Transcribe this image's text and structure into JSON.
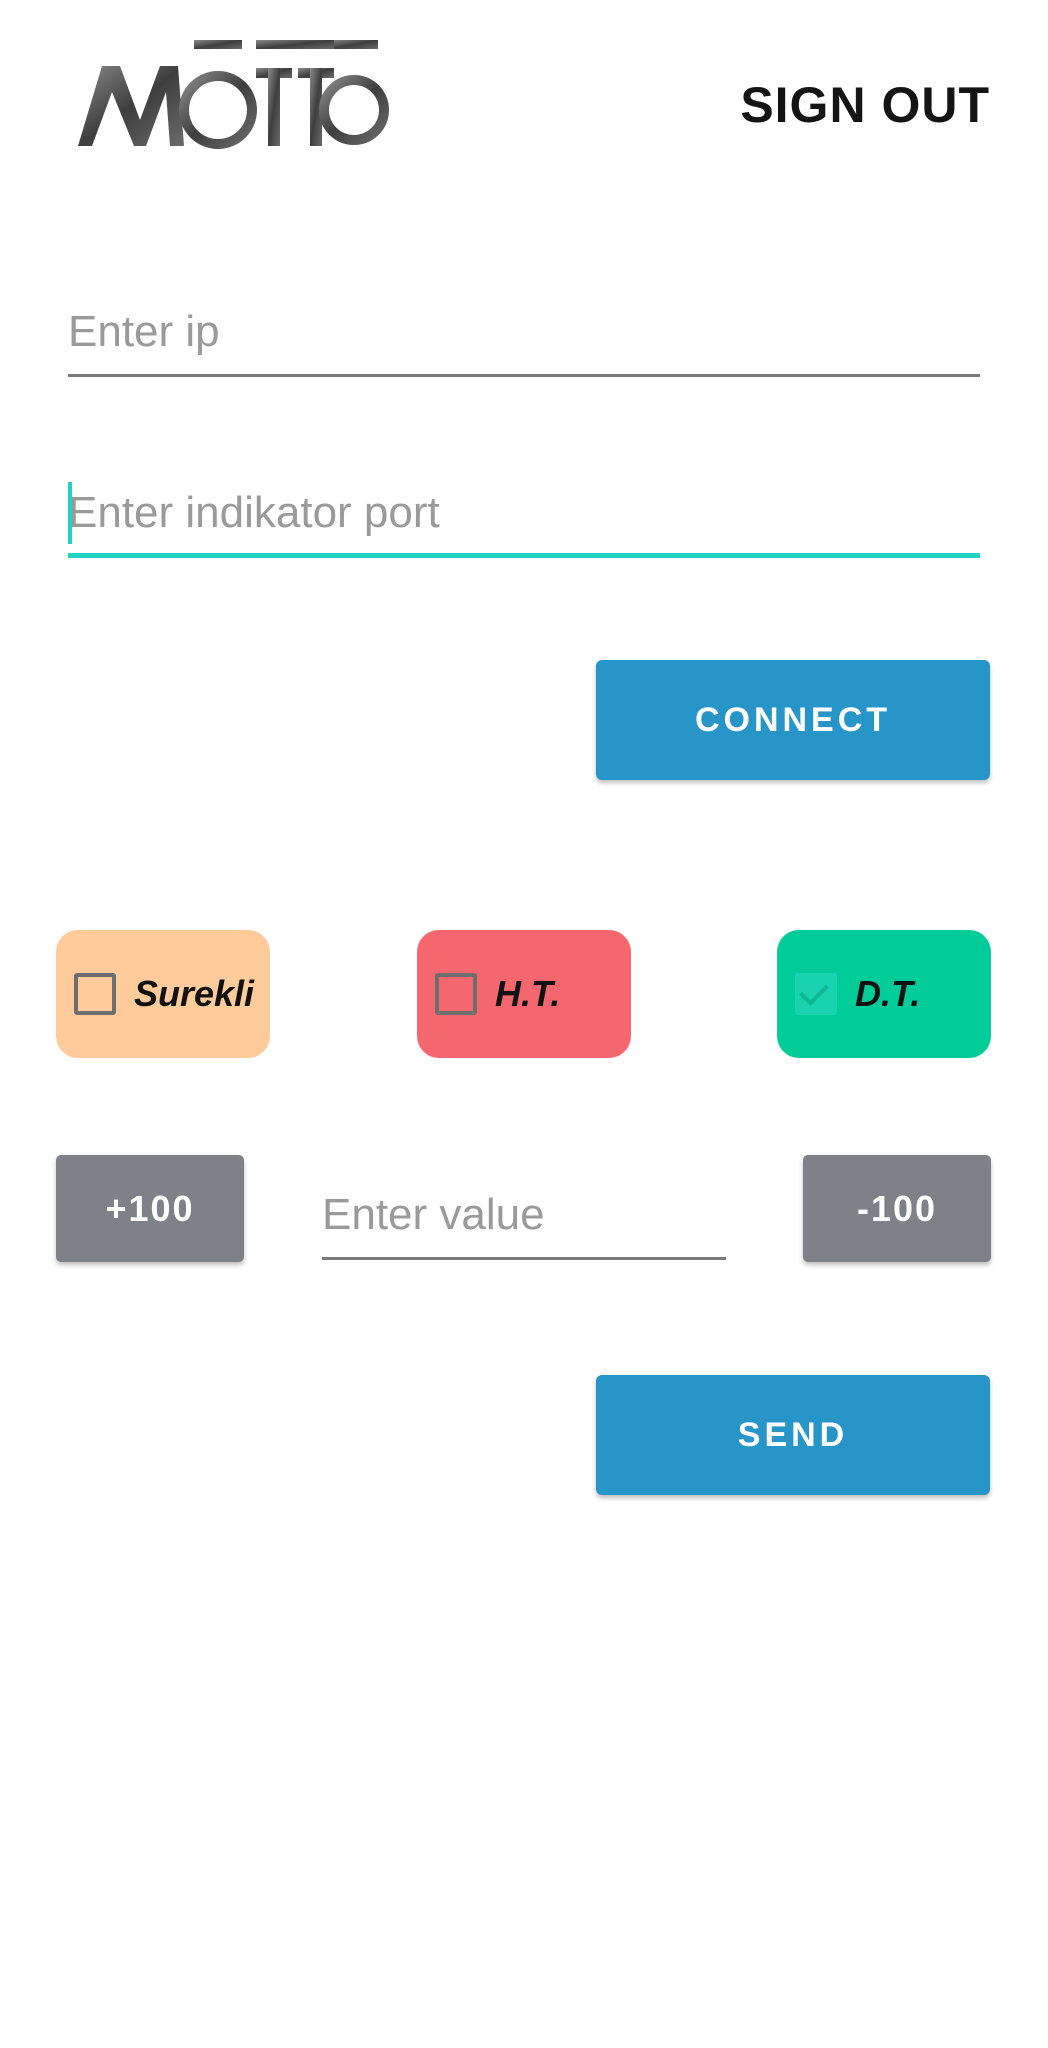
{
  "header": {
    "logo_text": "MŌTTŌ",
    "sign_out_label": "SIGN OUT"
  },
  "connection": {
    "ip_placeholder": "Enter ip",
    "ip_value": "",
    "port_placeholder": "Enter indikator port",
    "port_value": "",
    "connect_label": "CONNECT"
  },
  "modes": [
    {
      "label": "Surekli",
      "checked": false,
      "color": "#ffcb9a"
    },
    {
      "label": "H.T.",
      "checked": false,
      "color": "#f5676f"
    },
    {
      "label": "D.T.",
      "checked": true,
      "color": "#00cc99"
    }
  ],
  "stepper": {
    "plus_label": "+100",
    "minus_label": "-100",
    "value_placeholder": "Enter value",
    "value": ""
  },
  "send_label": "SEND",
  "colors": {
    "primary": "#2795c8",
    "accent": "#22d3c5",
    "stepper": "#7e8288"
  }
}
